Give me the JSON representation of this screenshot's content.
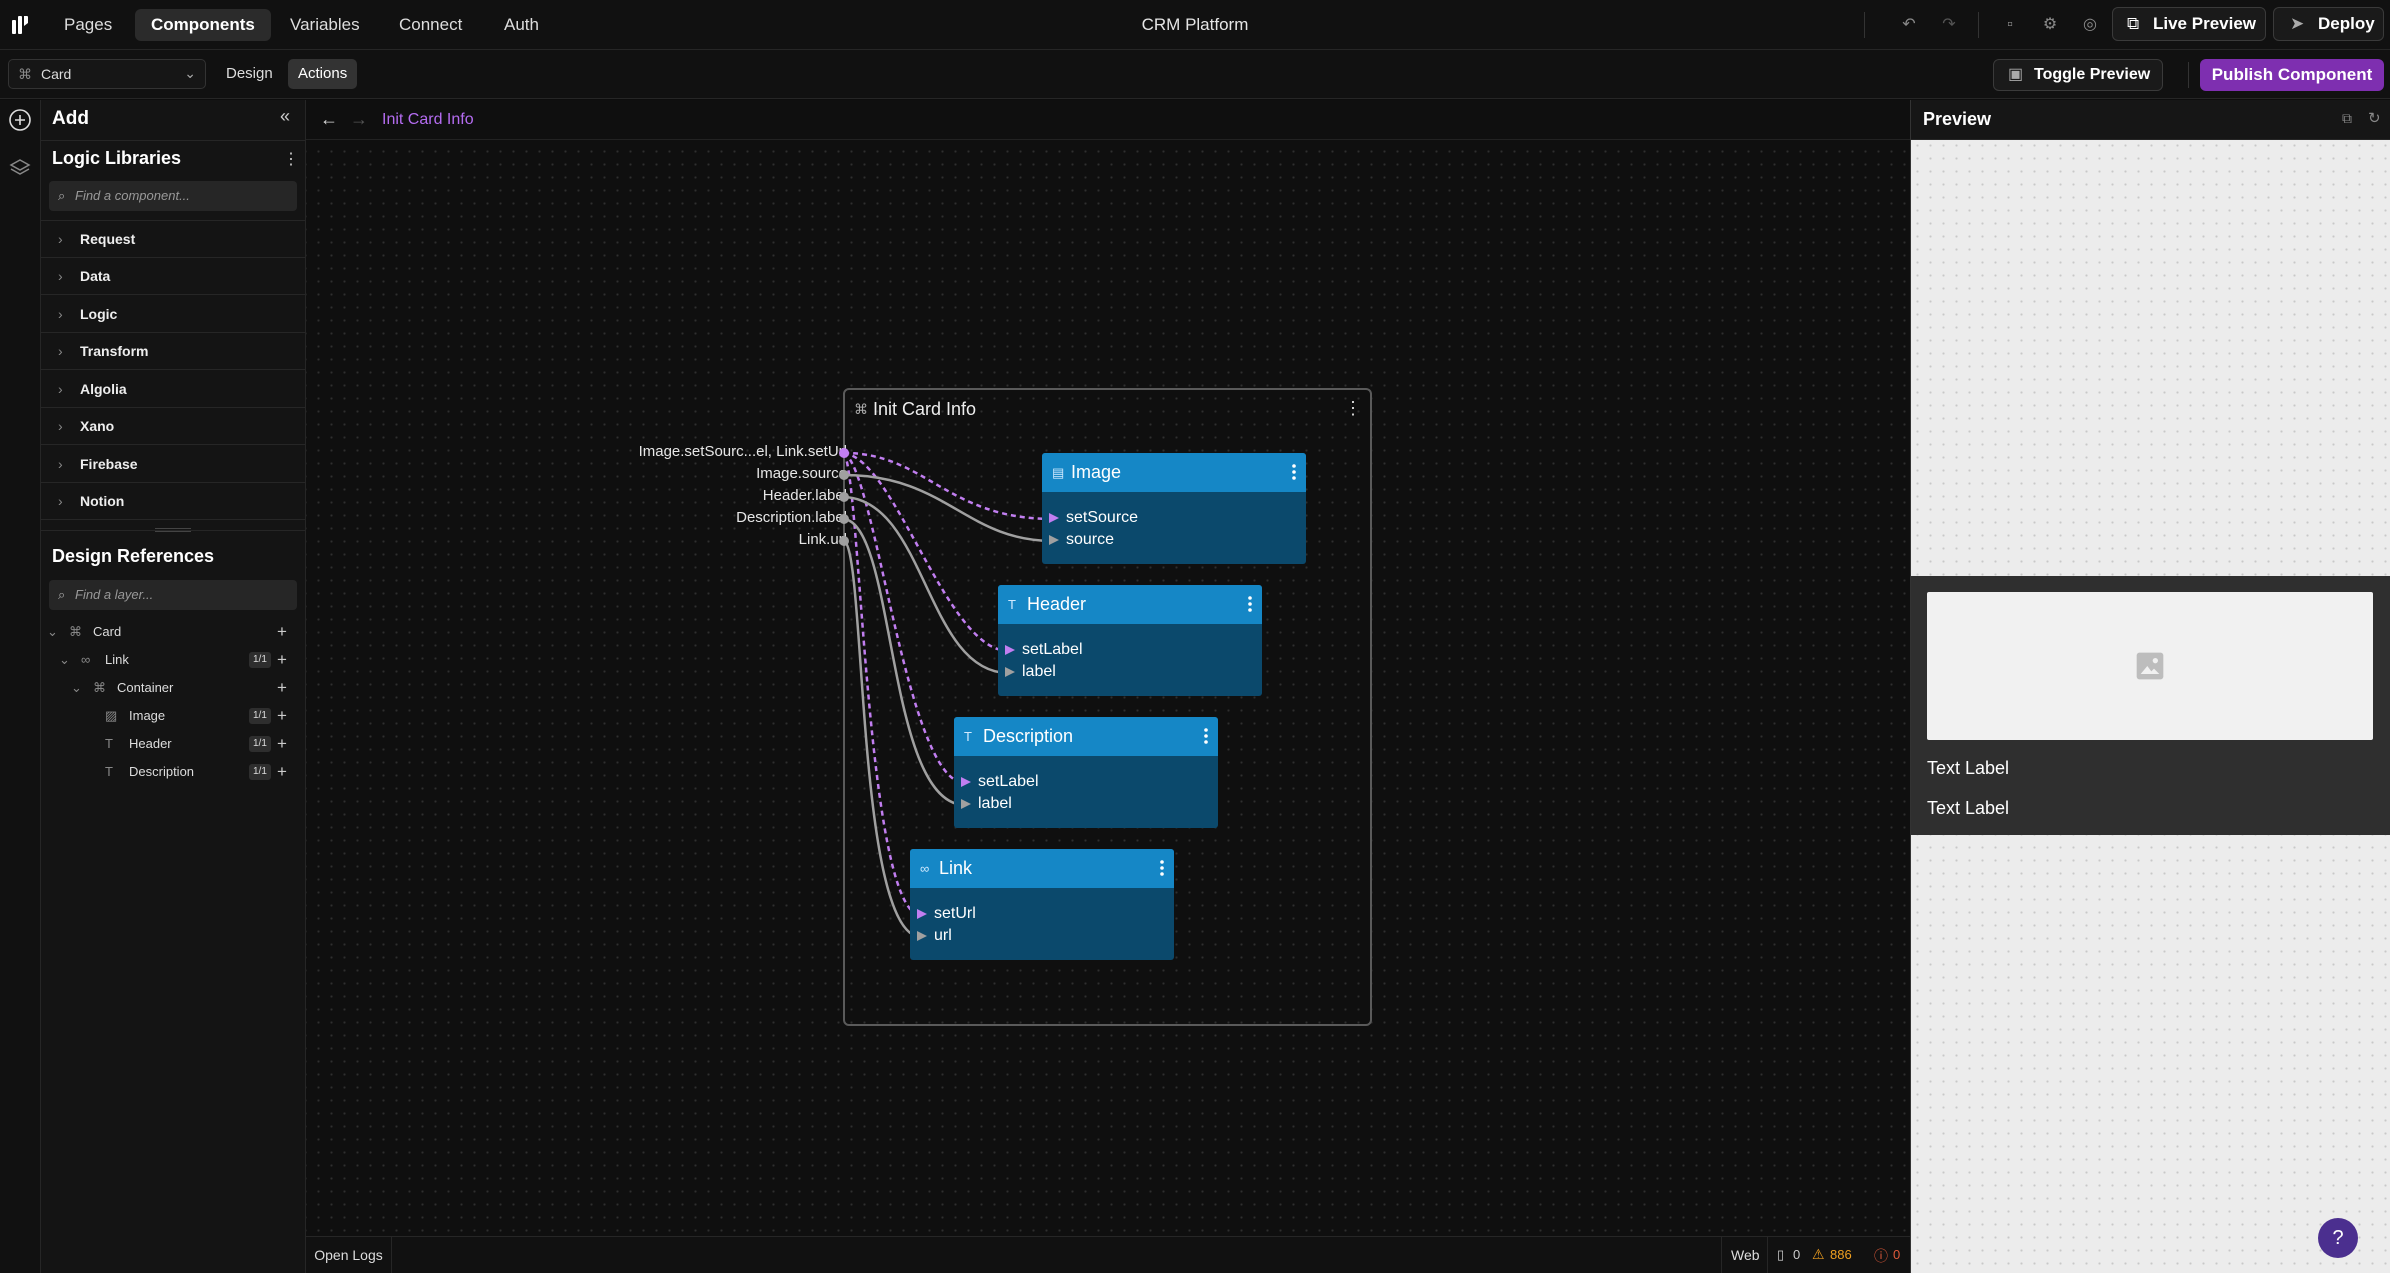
{
  "topbar": {
    "tabs": [
      {
        "label": "Pages",
        "active": false
      },
      {
        "label": "Components",
        "active": true
      },
      {
        "label": "Variables",
        "active": false
      },
      {
        "label": "Connect",
        "active": false
      },
      {
        "label": "Auth",
        "active": false
      }
    ],
    "app_title": "CRM Platform",
    "live_preview": "Live Preview",
    "deploy": "Deploy"
  },
  "subbar": {
    "component_select": "Card",
    "tabs": [
      {
        "label": "Design",
        "active": false
      },
      {
        "label": "Actions",
        "active": true
      }
    ],
    "toggle_preview": "Toggle Preview",
    "publish": "Publish Component"
  },
  "left_panel": {
    "add_title": "Add",
    "logic_libraries": {
      "title": "Logic Libraries",
      "search_placeholder": "Find a component...",
      "items": [
        "Request",
        "Data",
        "Logic",
        "Transform",
        "Algolia",
        "Xano",
        "Firebase",
        "Notion"
      ]
    },
    "design_references": {
      "title": "Design References",
      "search_placeholder": "Find a layer...",
      "layers": [
        {
          "name": "Card",
          "badge": "",
          "icon": "component-icon"
        },
        {
          "name": "Link",
          "badge": "1/1",
          "icon": "link-icon"
        },
        {
          "name": "Container",
          "badge": "",
          "icon": "component-icon"
        },
        {
          "name": "Image",
          "badge": "1/1",
          "icon": "image-icon"
        },
        {
          "name": "Header",
          "badge": "1/1",
          "icon": "text-icon"
        },
        {
          "name": "Description",
          "badge": "1/1",
          "icon": "text-icon"
        }
      ]
    }
  },
  "canvas": {
    "breadcrumb": "Init Card Info",
    "group": {
      "title": "Init Card Info",
      "outputs": [
        "Image.setSourc...el, Link.setUrl",
        "Image.source",
        "Header.label",
        "Description.label",
        "Link.url"
      ]
    },
    "nodes": [
      {
        "title": "Image",
        "ports": [
          "setSource",
          "source"
        ]
      },
      {
        "title": "Header",
        "ports": [
          "setLabel",
          "label"
        ]
      },
      {
        "title": "Description",
        "ports": [
          "setLabel",
          "label"
        ]
      },
      {
        "title": "Link",
        "ports": [
          "setUrl",
          "url"
        ]
      }
    ],
    "colors": {
      "node_header": "#1587c6",
      "node_body": "#0b496c",
      "event_wire": "#c17ef0",
      "data_wire": "#a0a0a0"
    }
  },
  "statusbar": {
    "open_logs": "Open Logs",
    "platform": "Web",
    "info_count": "0",
    "warning_count": "886",
    "error_count": "0"
  },
  "preview": {
    "title": "Preview",
    "text_1": "Text Label",
    "text_2": "Text Label"
  },
  "help": "?"
}
